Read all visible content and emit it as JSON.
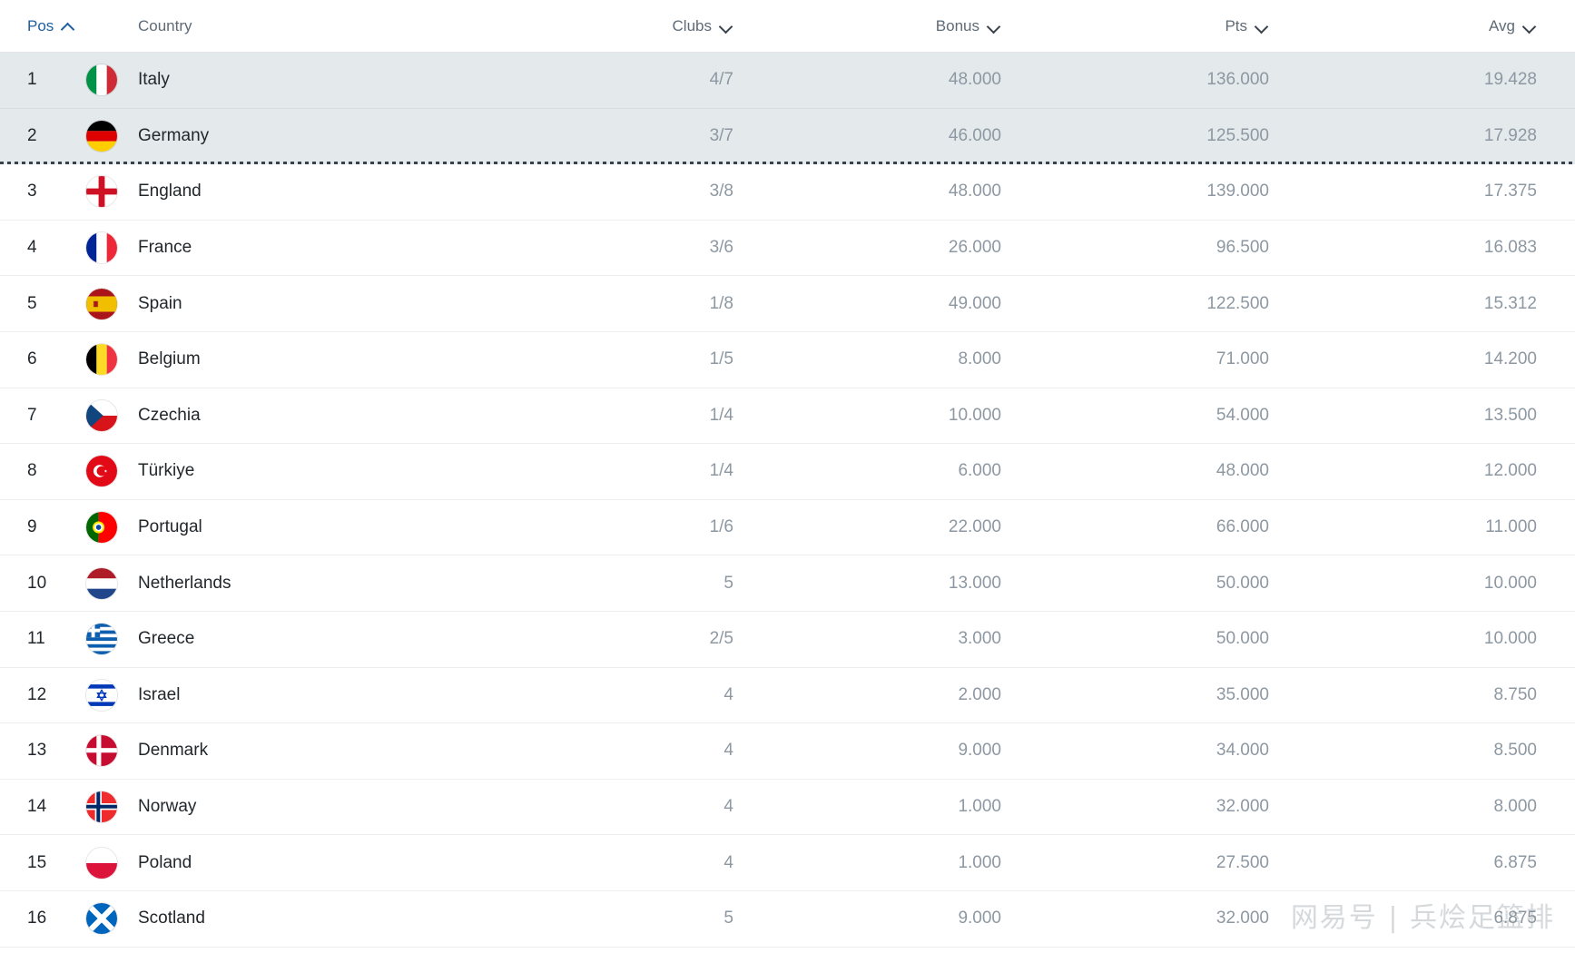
{
  "table": {
    "columns": [
      {
        "key": "pos",
        "label": "Pos",
        "sort": "asc",
        "align": "left"
      },
      {
        "key": "country",
        "label": "Country",
        "sort": "none",
        "align": "left"
      },
      {
        "key": "clubs",
        "label": "Clubs",
        "sort": "desc",
        "align": "right"
      },
      {
        "key": "bonus",
        "label": "Bonus",
        "sort": "desc",
        "align": "right"
      },
      {
        "key": "pts",
        "label": "Pts",
        "sort": "desc",
        "align": "right"
      },
      {
        "key": "avg",
        "label": "Avg",
        "sort": "desc",
        "align": "right"
      }
    ],
    "rows": [
      {
        "pos": "1",
        "country": "Italy",
        "flag": "flag-italy",
        "clubs": "4/7",
        "bonus": "48.000",
        "pts": "136.000",
        "avg": "19.428",
        "highlight": true
      },
      {
        "pos": "2",
        "country": "Germany",
        "flag": "flag-germany",
        "clubs": "3/7",
        "bonus": "46.000",
        "pts": "125.500",
        "avg": "17.928",
        "highlight": true
      },
      {
        "pos": "3",
        "country": "England",
        "flag": "flag-england",
        "clubs": "3/8",
        "bonus": "48.000",
        "pts": "139.000",
        "avg": "17.375",
        "highlight": false
      },
      {
        "pos": "4",
        "country": "France",
        "flag": "flag-france",
        "clubs": "3/6",
        "bonus": "26.000",
        "pts": "96.500",
        "avg": "16.083",
        "highlight": false
      },
      {
        "pos": "5",
        "country": "Spain",
        "flag": "flag-spain",
        "clubs": "1/8",
        "bonus": "49.000",
        "pts": "122.500",
        "avg": "15.312",
        "highlight": false
      },
      {
        "pos": "6",
        "country": "Belgium",
        "flag": "flag-belgium",
        "clubs": "1/5",
        "bonus": "8.000",
        "pts": "71.000",
        "avg": "14.200",
        "highlight": false
      },
      {
        "pos": "7",
        "country": "Czechia",
        "flag": "flag-czechia",
        "clubs": "1/4",
        "bonus": "10.000",
        "pts": "54.000",
        "avg": "13.500",
        "highlight": false
      },
      {
        "pos": "8",
        "country": "Türkiye",
        "flag": "flag-turkiye",
        "clubs": "1/4",
        "bonus": "6.000",
        "pts": "48.000",
        "avg": "12.000",
        "highlight": false
      },
      {
        "pos": "9",
        "country": "Portugal",
        "flag": "flag-portugal",
        "clubs": "1/6",
        "bonus": "22.000",
        "pts": "66.000",
        "avg": "11.000",
        "highlight": false
      },
      {
        "pos": "10",
        "country": "Netherlands",
        "flag": "flag-netherlands",
        "clubs": "5",
        "bonus": "13.000",
        "pts": "50.000",
        "avg": "10.000",
        "highlight": false
      },
      {
        "pos": "11",
        "country": "Greece",
        "flag": "flag-greece",
        "clubs": "2/5",
        "bonus": "3.000",
        "pts": "50.000",
        "avg": "10.000",
        "highlight": false
      },
      {
        "pos": "12",
        "country": "Israel",
        "flag": "flag-israel",
        "clubs": "4",
        "bonus": "2.000",
        "pts": "35.000",
        "avg": "8.750",
        "highlight": false
      },
      {
        "pos": "13",
        "country": "Denmark",
        "flag": "flag-denmark",
        "clubs": "4",
        "bonus": "9.000",
        "pts": "34.000",
        "avg": "8.500",
        "highlight": false
      },
      {
        "pos": "14",
        "country": "Norway",
        "flag": "flag-norway",
        "clubs": "4",
        "bonus": "1.000",
        "pts": "32.000",
        "avg": "8.000",
        "highlight": false
      },
      {
        "pos": "15",
        "country": "Poland",
        "flag": "flag-poland",
        "clubs": "4",
        "bonus": "1.000",
        "pts": "27.500",
        "avg": "6.875",
        "highlight": false
      },
      {
        "pos": "16",
        "country": "Scotland",
        "flag": "flag-scotland",
        "clubs": "5",
        "bonus": "9.000",
        "pts": "32.000",
        "avg": "6.875",
        "highlight": false
      }
    ],
    "qualification_divider_after_row": 2
  },
  "watermark": {
    "text": "网易号 | 兵烩足篮排"
  },
  "colors": {
    "accent": "#1f5fa0",
    "header_text": "#5f6b76",
    "value_text": "#8d98a2",
    "primary_text": "#22272c",
    "row_highlight": "#e4e9ec",
    "row_border": "#eceef0"
  }
}
